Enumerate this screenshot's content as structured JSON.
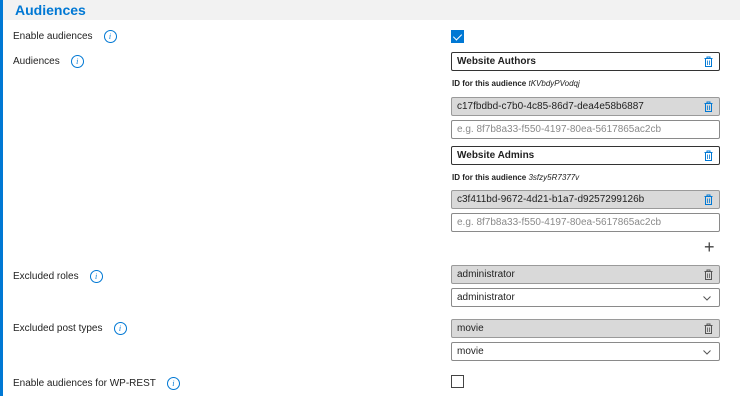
{
  "section": {
    "title": "Audiences"
  },
  "rows": {
    "enable_audiences": {
      "label": "Enable audiences",
      "checked": true
    },
    "audiences": {
      "label": "Audiences"
    },
    "excluded_roles": {
      "label": "Excluded roles"
    },
    "excluded_post_types": {
      "label": "Excluded post types"
    },
    "enable_wp_rest": {
      "label": "Enable audiences for WP-REST",
      "checked": false
    }
  },
  "audiences": [
    {
      "name": "Website Authors",
      "id_prefix": "ID for this audience",
      "id_value": "tKVbdyPVodqj",
      "group_id": "c17fbdbd-c7b0-4c85-86d7-dea4e58b6887",
      "group_placeholder": "e.g. 8f7b8a33-f550-4197-80ea-5617865ac2cb"
    },
    {
      "name": "Website Admins",
      "id_prefix": "ID for this audience",
      "id_value": "3sfzy5R7377v",
      "group_id": "c3f411bd-9672-4d21-b1a7-d9257299126b",
      "group_placeholder": "e.g. 8f7b8a33-f550-4197-80ea-5617865ac2cb"
    }
  ],
  "add_icon": "+",
  "excluded_roles": {
    "selected_item": "administrator",
    "select_value": "administrator"
  },
  "excluded_post_types": {
    "selected_item": "movie",
    "select_value": "movie"
  },
  "icons": {
    "info": "info-icon",
    "trash": "trash-icon",
    "chevron": "chevron-down-icon",
    "plus": "plus-icon"
  },
  "colors": {
    "accent": "#0078d4",
    "header_bg": "#f2f2f2",
    "selected_bg": "#d9d9d9"
  }
}
